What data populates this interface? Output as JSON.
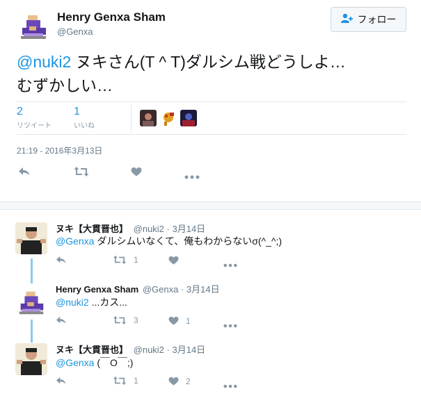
{
  "main_tweet": {
    "name": "Henry Genxa Sham",
    "handle": "@Genxa",
    "follow_label": "フォロー",
    "mention": "@nuki2",
    "text_line1": " ヌキさん(T ^ T)ダルシム戦どうしよ…",
    "text_line2": "むずかしい…",
    "retweets": {
      "count": "2",
      "label": "リツイート"
    },
    "likes": {
      "count": "1",
      "label": "いいね"
    },
    "timestamp": "21:19 - 2016年3月13日"
  },
  "replies": [
    {
      "name": "ヌキ【大貫晋也】",
      "handle": "@nuki2",
      "date": "· 3月14日",
      "mention": "@Genxa",
      "text": " ダルシムいなくて、俺もわからないσ(^_^;)",
      "retweets": "1",
      "likes": ""
    },
    {
      "name": "Henry Genxa Sham",
      "handle": "@Genxa",
      "date": "· 3月14日",
      "mention": "@nuki2",
      "text": " ...カス...",
      "retweets": "3",
      "likes": "1"
    },
    {
      "name": "ヌキ【大貫晋也】",
      "handle": "@nuki2",
      "date": "· 3月14日",
      "mention": "@Genxa",
      "text": " (￣O￣;)",
      "retweets": "1",
      "likes": "2"
    }
  ],
  "colors": {
    "link": "#1b95e0",
    "thread_line": "#88c9f0",
    "divider": "#e1e8ed",
    "icon": "#8899a6"
  }
}
